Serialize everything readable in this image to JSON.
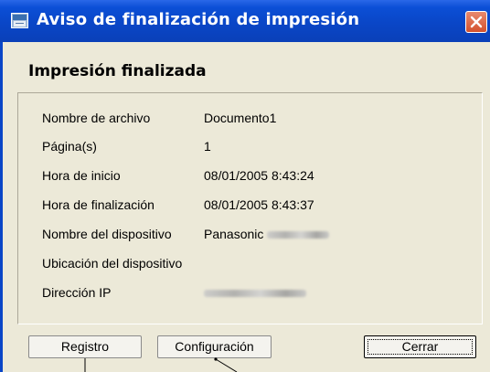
{
  "window": {
    "title": "Aviso de finalización de impresión",
    "heading": "Impresión finalizada"
  },
  "details": [
    {
      "label": "Nombre de archivo",
      "value": "Documento1"
    },
    {
      "label": "Página(s)",
      "value": "1"
    },
    {
      "label": "Hora de inicio",
      "value": "08/01/2005 8:43:24"
    },
    {
      "label": "Hora de finalización",
      "value": "08/01/2005 8:43:37"
    },
    {
      "label": "Nombre del dispositivo",
      "value": "Panasonic"
    },
    {
      "label": "Ubicación del dispositivo",
      "value": ""
    },
    {
      "label": "Dirección IP",
      "value": ""
    }
  ],
  "buttons": {
    "registro": "Registro",
    "configuracion": "Configuración",
    "cerrar": "Cerrar"
  },
  "icons": {
    "app": "printer-icon",
    "close": "close-icon"
  },
  "colors": {
    "titlebar": "#0a46c7",
    "close_button": "#d4512c",
    "dialog_background": "#ece9d8"
  }
}
